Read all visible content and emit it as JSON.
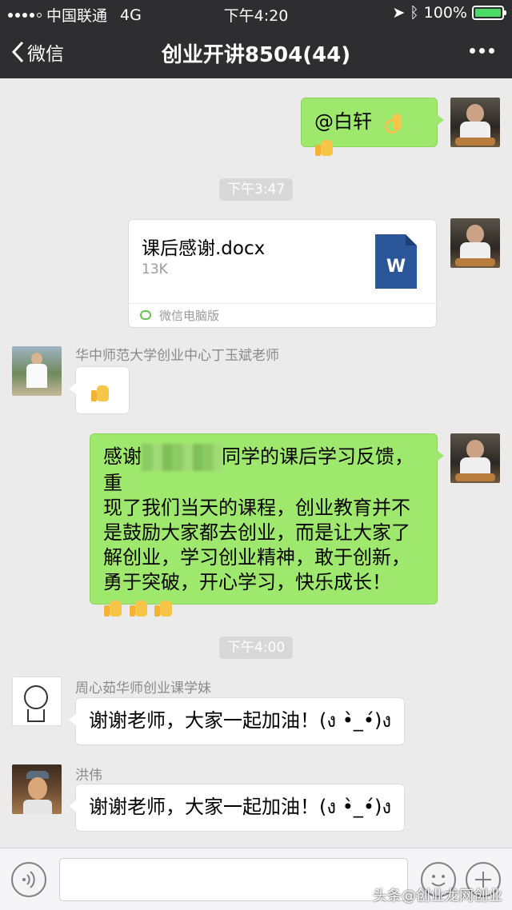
{
  "status_bar": {
    "carrier": "中国联通",
    "network": "4G",
    "time": "下午4:20",
    "battery": "100%",
    "battery_level": 1.0
  },
  "nav": {
    "back_label": "微信",
    "title": "创业开讲8504(44)"
  },
  "messages": {
    "m1_text": "@白轩",
    "time1": "下午3:47",
    "file_name": "课后感谢.docx",
    "file_size": "13K",
    "file_icon_letter": "W",
    "file_source": "微信电脑版",
    "sender2": "华中师范大学创业中心丁玉斌老师",
    "m4_line1a": "感谢",
    "m4_line1b": "同学的课后学习反馈，重",
    "m4_line2": "现了我们当天的课程，创业教育并不",
    "m4_line3": "是鼓励大家都去创业，而是让大家了",
    "m4_line4": "解创业，学习创业精神，敢于创新，",
    "m4_line5": "勇于突破，开心学习，快乐成长！",
    "time2": "下午4:00",
    "sender3": "周心茹华师创业课学妹",
    "m5_text": "谢谢老师，大家一起加油！(ง •̀_•́)ง",
    "sender4": "洪伟",
    "m6_text": "谢谢老师，大家一起加油！(ง •̀_•́)ง"
  },
  "watermark": "头条@创业龙网创业",
  "icons": [
    "voice-icon",
    "emoji-icon",
    "plus-icon",
    "back-chevron-icon",
    "more-icon",
    "word-file-icon",
    "thumbs-up-icon",
    "ok-hand-icon"
  ]
}
